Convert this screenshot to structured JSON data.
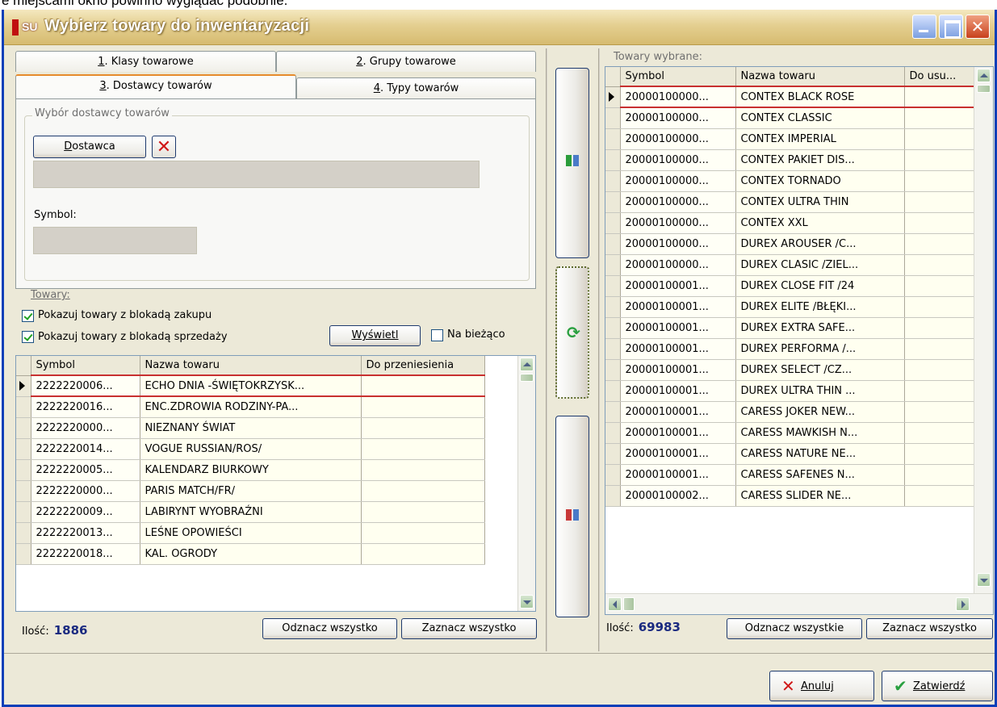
{
  "caption": "e miejscami okno powinno wyglądać podobnie.",
  "window": {
    "title": "Wybierz towary do inwentaryzacji",
    "icon_text": "SU"
  },
  "tabs": [
    {
      "num": "1",
      "text": ". Klasy towarowe"
    },
    {
      "num": "2",
      "text": ". Grupy towarowe"
    },
    {
      "num": "3",
      "text": ". Dostawcy towarów"
    },
    {
      "num": "4",
      "text": ". Typy towarów"
    }
  ],
  "supplier": {
    "group_label": "Wybór dostawcy towarów",
    "button_first": "D",
    "button_rest": "ostawca",
    "symbol_label": "Symbol:"
  },
  "left": {
    "group_label": "Towary:",
    "check_purchase": "Pokazuj towary z blokadą zakupu",
    "check_sale": "Pokazuj towary z blokadą sprzedaży",
    "show_button": "Wyświetl",
    "current_label": "Na bieżąco",
    "columns": [
      "Symbol",
      "Nazwa towaru",
      "Do przeniesienia"
    ],
    "rows": [
      [
        "2222220006...",
        "ECHO DNIA -ŚWIĘTOKRZYSK...",
        ""
      ],
      [
        "2222220016...",
        "ENC.ZDROWIA RODZINY-PA...",
        ""
      ],
      [
        "2222220000...",
        "NIEZNANY ŚWIAT",
        ""
      ],
      [
        "2222220014...",
        "VOGUE RUSSIAN/ROS/",
        ""
      ],
      [
        "2222220005...",
        "KALENDARZ BIURKOWY",
        ""
      ],
      [
        "2222220000...",
        "PARIS MATCH/FR/",
        ""
      ],
      [
        "2222220009...",
        "LABIRYNT WYOBRAŹNI",
        ""
      ],
      [
        "2222220013...",
        "LEŚNE OPOWIEŚCI",
        ""
      ],
      [
        "2222220018...",
        "KAL. OGRODY",
        ""
      ]
    ],
    "count_label": "Ilość:",
    "count_value": "1886",
    "deselect_all": "Odznacz wszystko",
    "select_all": "Zaznacz wszystko"
  },
  "right": {
    "group_label": "Towary wybrane:",
    "columns": [
      "Symbol",
      "Nazwa towaru",
      "Do usu..."
    ],
    "rows": [
      [
        "20000100000...",
        "CONTEX BLACK ROSE",
        ""
      ],
      [
        "20000100000...",
        "CONTEX CLASSIC",
        ""
      ],
      [
        "20000100000...",
        "CONTEX IMPERIAL",
        ""
      ],
      [
        "20000100000...",
        "CONTEX PAKIET DIS...",
        ""
      ],
      [
        "20000100000...",
        "CONTEX TORNADO",
        ""
      ],
      [
        "20000100000...",
        "CONTEX ULTRA THIN",
        ""
      ],
      [
        "20000100000...",
        "CONTEX XXL",
        ""
      ],
      [
        "20000100000...",
        "DUREX AROUSER /C...",
        ""
      ],
      [
        "20000100000...",
        "DUREX CLASIC /ZIEL...",
        ""
      ],
      [
        "20000100001...",
        "DUREX CLOSE FIT  /24",
        ""
      ],
      [
        "20000100001...",
        "DUREX ELITE /BŁĘKI...",
        ""
      ],
      [
        "20000100001...",
        "DUREX EXTRA SAFE...",
        ""
      ],
      [
        "20000100001...",
        "DUREX PERFORMA /...",
        ""
      ],
      [
        "20000100001...",
        "DUREX SELECT /CZ...",
        ""
      ],
      [
        "20000100001...",
        "DUREX ULTRA THIN ...",
        ""
      ],
      [
        "20000100001...",
        "CARESS JOKER NEW...",
        ""
      ],
      [
        "20000100001...",
        "CARESS MAWKISH N...",
        ""
      ],
      [
        "20000100001...",
        "CARESS NATURE NE...",
        ""
      ],
      [
        "20000100001...",
        "CARESS SAFENES N...",
        ""
      ],
      [
        "20000100002...",
        "CARESS SLIDER NE...",
        ""
      ]
    ],
    "count_label": "Ilość:",
    "count_value": "69983",
    "deselect_all": "Odznacz wszystkie",
    "select_all": "Zaznacz wszystko"
  },
  "footer": {
    "cancel": "Anuluj",
    "confirm": "Zatwierdź"
  },
  "icons": {
    "move_right": "move-right-icon",
    "swap": "refresh-icon",
    "move_left": "move-left-icon",
    "cancel": "x-icon",
    "confirm": "check-icon"
  },
  "colors": {
    "count": "#1a2a80",
    "selected_row_border": "#c83030",
    "cancel_icon": "#d01818",
    "confirm_icon": "#2aa040"
  }
}
